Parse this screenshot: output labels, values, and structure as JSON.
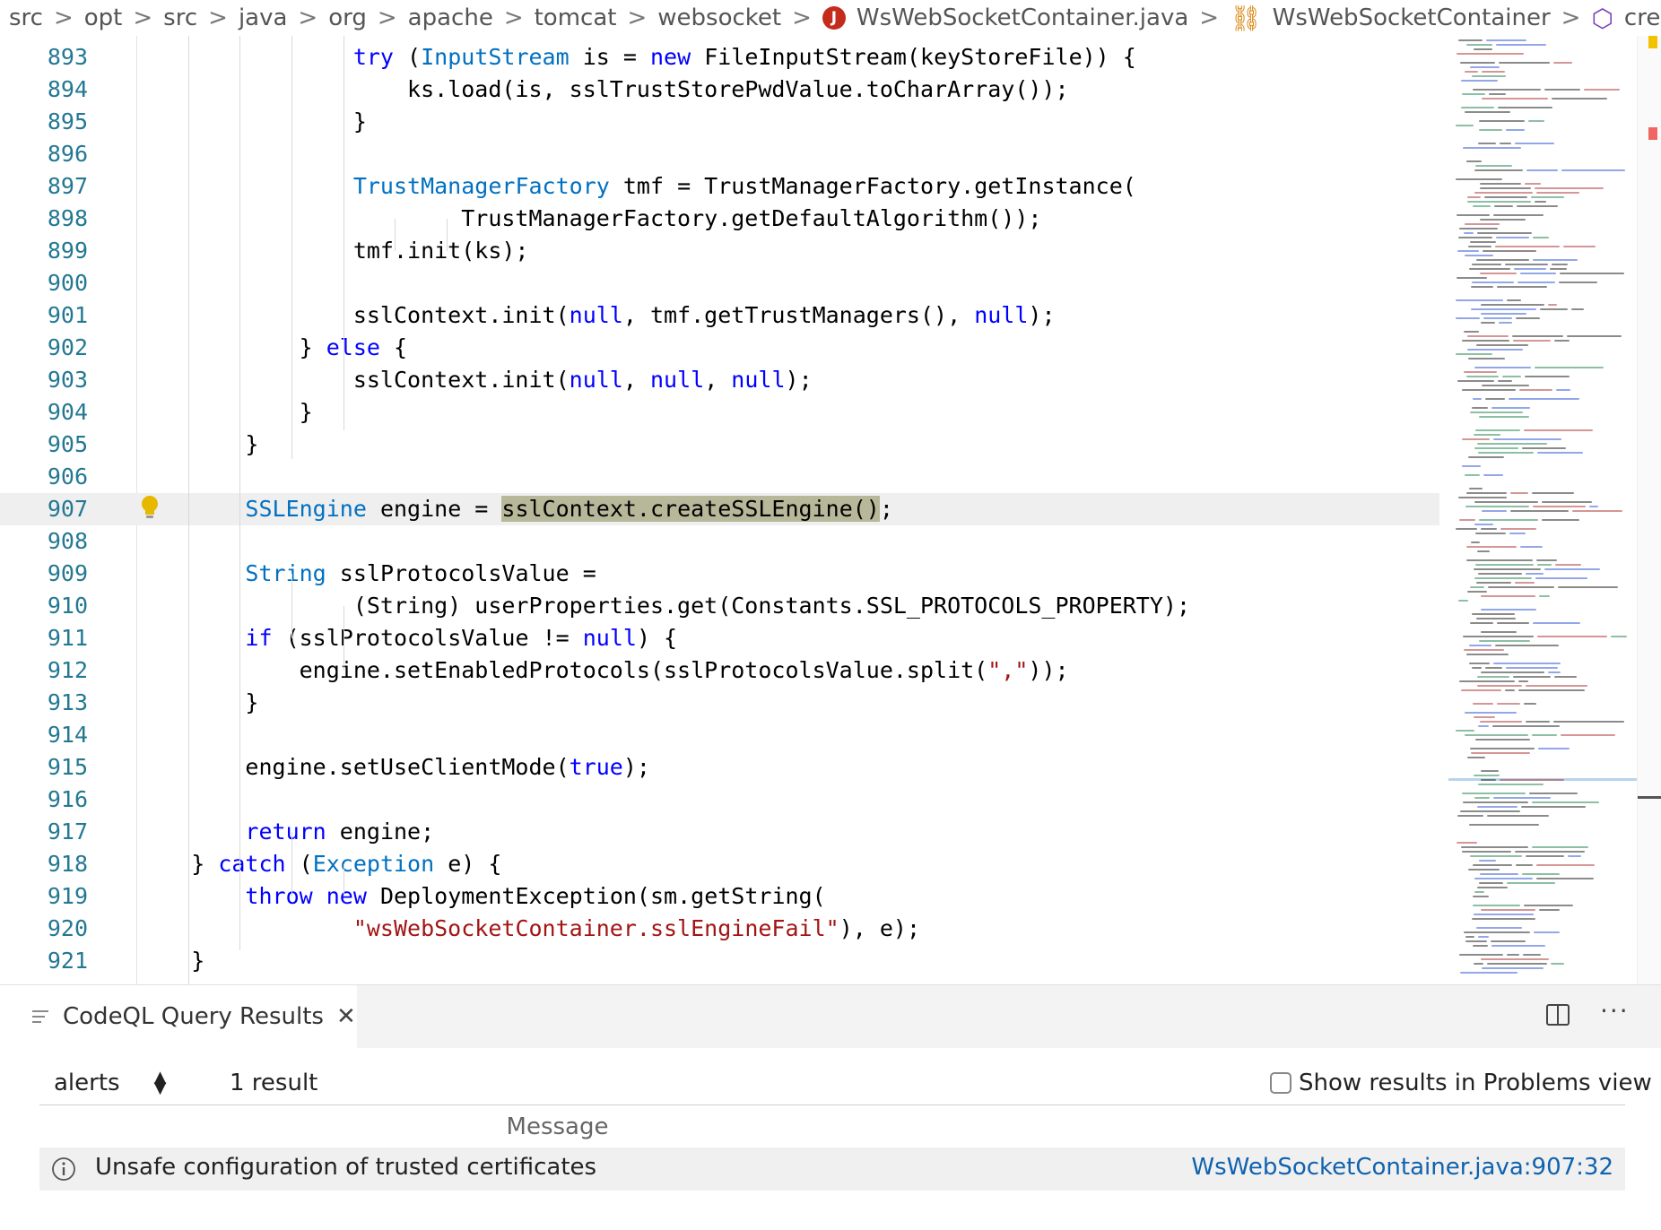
{
  "breadcrumb": {
    "items": [
      "src",
      "opt",
      "src",
      "java",
      "org",
      "apache",
      "tomcat",
      "websocket"
    ],
    "file": "WsWebSocketContainer.java",
    "file_icon": "java-file-icon",
    "class": "WsWebSocketContainer",
    "class_icon": "class-icon",
    "method": "createSSLEngine(Ma",
    "method_icon": "method-icon",
    "separator": ">"
  },
  "editor": {
    "current_line": 907,
    "lines": [
      {
        "n": "893",
        "html": "                <span class=\"kw\">try</span> (<span class=\"ty\">InputStream</span> is = <span class=\"kw\">new</span> FileInputStream(keyStoreFile)) {"
      },
      {
        "n": "894",
        "html": "                    ks.load(is, sslTrustStorePwdValue.toCharArray());"
      },
      {
        "n": "895",
        "html": "                }"
      },
      {
        "n": "896",
        "html": ""
      },
      {
        "n": "897",
        "html": "                <span class=\"ty\">TrustManagerFactory</span> tmf = TrustManagerFactory.getInstance("
      },
      {
        "n": "898",
        "html": "                        TrustManagerFactory.getDefaultAlgorithm());"
      },
      {
        "n": "899",
        "html": "                tmf.init(ks);"
      },
      {
        "n": "900",
        "html": ""
      },
      {
        "n": "901",
        "html": "                sslContext.init(<span class=\"kw\">null</span>, tmf.getTrustManagers(), <span class=\"kw\">null</span>);"
      },
      {
        "n": "902",
        "html": "            } <span class=\"kw\">else</span> {"
      },
      {
        "n": "903",
        "html": "                sslContext.init(<span class=\"kw\">null</span>, <span class=\"kw\">null</span>, <span class=\"kw\">null</span>);"
      },
      {
        "n": "904",
        "html": "            }"
      },
      {
        "n": "905",
        "html": "        }"
      },
      {
        "n": "906",
        "html": ""
      },
      {
        "n": "907",
        "html": "        <span class=\"ty\">SSLEngine</span> engine = <span class=\"hl\">sslContext.createSSLEngine()</span>;"
      },
      {
        "n": "908",
        "html": ""
      },
      {
        "n": "909",
        "html": "        <span class=\"ty\">String</span> sslProtocolsValue ="
      },
      {
        "n": "910",
        "html": "                (String) userProperties.get(Constants.SSL_PROTOCOLS_PROPERTY);"
      },
      {
        "n": "911",
        "html": "        <span class=\"kw\">if</span> (sslProtocolsValue != <span class=\"kw\">null</span>) {"
      },
      {
        "n": "912",
        "html": "            engine.setEnabledProtocols(sslProtocolsValue.split(<span class=\"str\">\",\"</span>));"
      },
      {
        "n": "913",
        "html": "        }"
      },
      {
        "n": "914",
        "html": ""
      },
      {
        "n": "915",
        "html": "        engine.setUseClientMode(<span class=\"kw\">true</span>);"
      },
      {
        "n": "916",
        "html": ""
      },
      {
        "n": "917",
        "html": "        <span class=\"kw\">return</span> engine;"
      },
      {
        "n": "918",
        "html": "    } <span class=\"kw\">catch</span> (<span class=\"ty\">Exception</span> e) {"
      },
      {
        "n": "919",
        "html": "        <span class=\"kw\">throw</span> <span class=\"kw\">new</span> DeploymentException(sm.getString("
      },
      {
        "n": "920",
        "html": "                <span class=\"str\">\"wsWebSocketContainer.sslEngineFail\"</span>), e);"
      },
      {
        "n": "921",
        "html": "    }"
      }
    ]
  },
  "colors": {
    "keyword": "#0000ff",
    "type": "#0070c1",
    "string": "#a31515",
    "line_number": "#237893",
    "selection_highlight": "#b7b79a",
    "link": "#0f62af"
  },
  "panel": {
    "tab_label": "CodeQL Query Results",
    "tab_icon": "list-icon",
    "close_icon": "close-icon",
    "split_icon": "split-editor-icon",
    "more_label": "···",
    "select_value": "alerts",
    "result_count": "1 result",
    "problems_toggle_label": "Show results in Problems view",
    "table": {
      "columns": [
        "Message"
      ],
      "rows": [
        {
          "icon": "info-icon",
          "message": "Unsafe configuration of trusted certificates",
          "location": "WsWebSocketContainer.java:907:32"
        }
      ]
    }
  }
}
